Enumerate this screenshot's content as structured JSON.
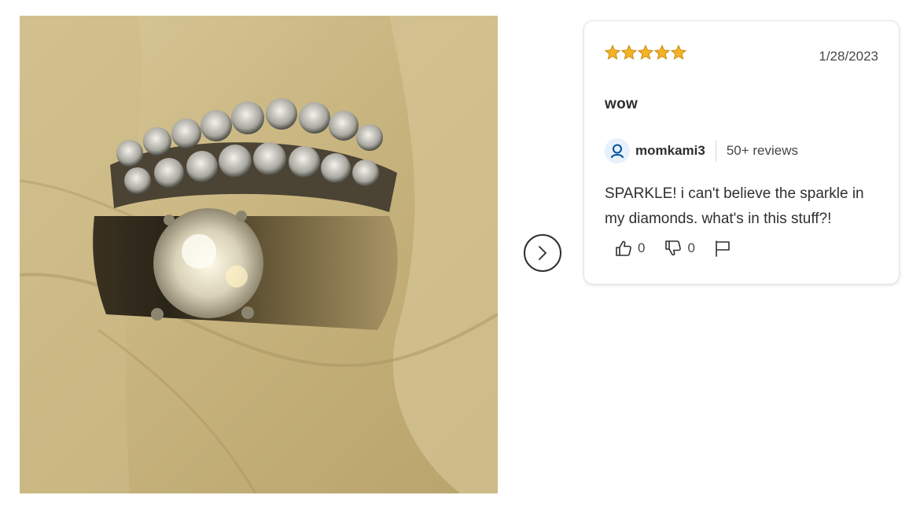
{
  "review": {
    "rating": 5,
    "date": "1/28/2023",
    "title": "wow",
    "reviewer": {
      "name": "momkami3",
      "reviews_count": "50+ reviews"
    },
    "body": "SPARKLE! i can't believe the sparkle in my diamonds. what's in this stuff?!",
    "helpful_count": "0",
    "unhelpful_count": "0"
  },
  "icons": {
    "next": "chevron-right-icon",
    "avatar": "user-icon",
    "helpful": "thumbs-up-icon",
    "unhelpful": "thumbs-down-icon",
    "report": "flag-icon",
    "rating": "star-icon"
  },
  "colors": {
    "star": "#f5b324",
    "avatar_bg": "#e6f1fc",
    "avatar_icon": "#004f9a",
    "text": "#2e2f32",
    "muted": "#46474a"
  }
}
